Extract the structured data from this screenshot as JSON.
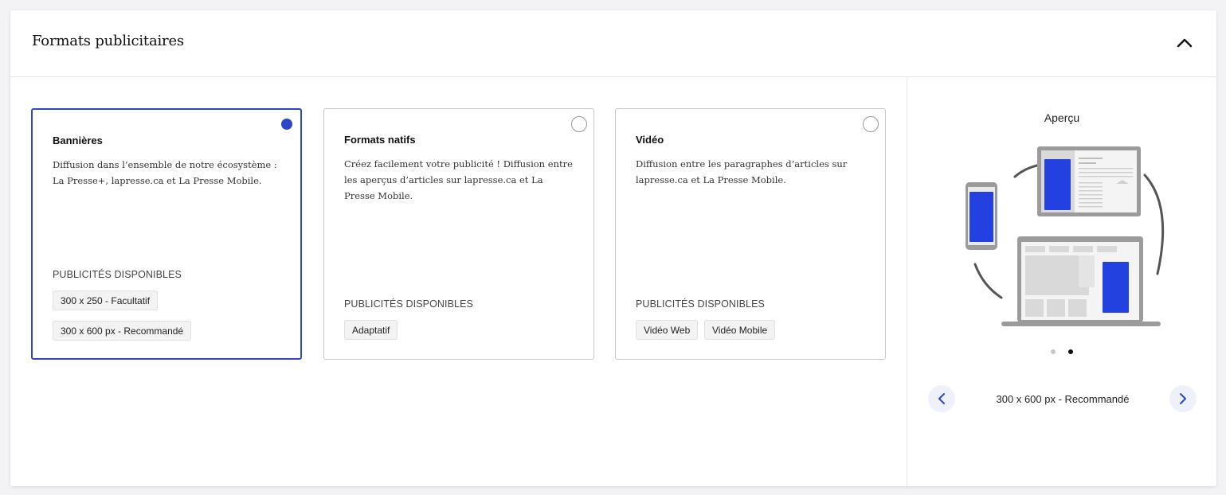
{
  "header": {
    "title": "Formats publicitaires",
    "collapse_icon": "chevron-up-icon"
  },
  "cards": [
    {
      "title": "Bannières",
      "description": "Diffusion dans l’ensemble de notre écosystème : La Presse+, lapresse.ca et La Presse Mobile.",
      "available_label": "PUBLICITÉS DISPONIBLES",
      "chips": [
        "300 x 250 - Facultatif",
        "300 x 600 px - Recommandé"
      ],
      "selected": true
    },
    {
      "title": "Formats natifs",
      "description": "Créez facilement votre publicité ! Diffusion entre les aperçus d’articles sur lapresse.ca et La Presse Mobile.",
      "available_label": "PUBLICITÉS DISPONIBLES",
      "chips": [
        "Adaptatif"
      ],
      "selected": false
    },
    {
      "title": "Vidéo",
      "description": "Diffusion entre les paragraphes d’articles sur lapresse.ca et La Presse Mobile.",
      "available_label": "PUBLICITÉS DISPONIBLES",
      "chips": [
        "Vidéo Web",
        "Vidéo Mobile"
      ],
      "selected": false
    }
  ],
  "preview": {
    "title": "Aperçu",
    "caption": "300 x 600 px - Recommandé",
    "dots": 2,
    "active_dot": 1,
    "prev_icon": "chevron-left-icon",
    "next_icon": "chevron-right-icon"
  },
  "colors": {
    "accent": "#2d47c8",
    "ad_blue": "#2340e0",
    "device_gray": "#9b9b9b"
  }
}
